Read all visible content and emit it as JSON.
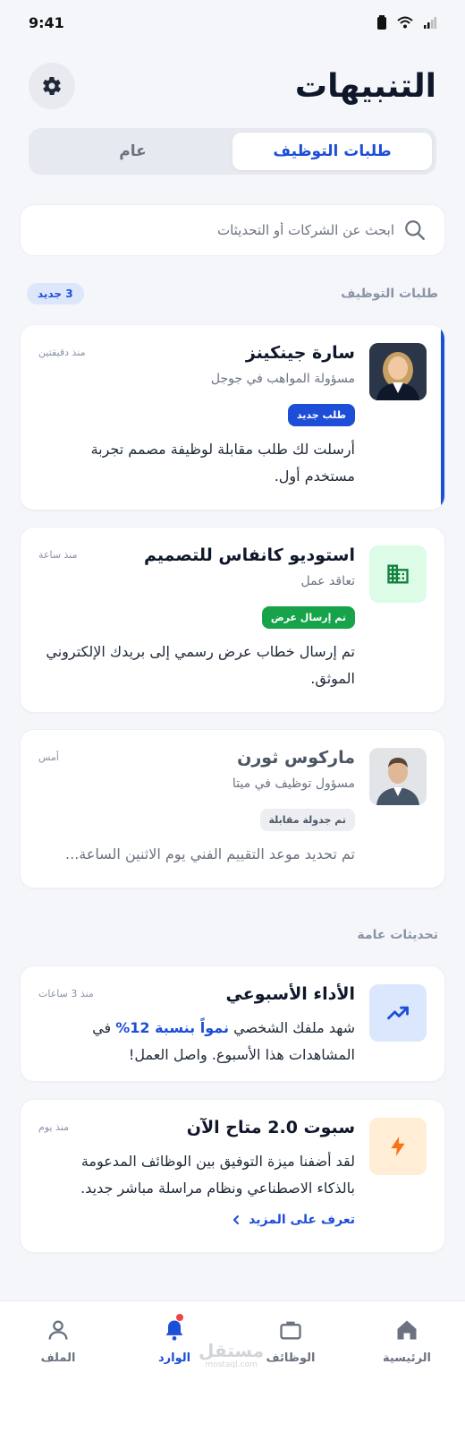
{
  "status_bar": {
    "time": "9:41"
  },
  "header": {
    "title": "التنبيهات"
  },
  "tabs": [
    {
      "label": "طلبات التوظيف",
      "active": true
    },
    {
      "label": "عام",
      "active": false
    }
  ],
  "search": {
    "placeholder": "ابحث عن الشركات أو التحديثات"
  },
  "applications_section": {
    "title": "طلبات التوظيف",
    "badge": "3 جديد"
  },
  "applications": [
    {
      "name": "سارة جينكينز",
      "subtitle": "مسؤولة المواهب في جوجل",
      "time": "منذ دقيقتين",
      "status": "طلب جديد",
      "body": "أرسلت لك طلب مقابلة لوظيفة مصمم تجربة مستخدم أول.",
      "unread": true
    },
    {
      "name": "استوديو كانفاس للتصميم",
      "subtitle": "تعاقد عمل",
      "time": "منذ ساعة",
      "status": "تم إرسال عرض",
      "body": "تم إرسال خطاب عرض رسمي إلى بريدك الإلكتروني الموثق."
    },
    {
      "name": "ماركوس ثورن",
      "subtitle": "مسؤول توظيف في ميتا",
      "time": "أمس",
      "status": "تم جدولة مقابلة",
      "body": "تم تحديد موعد التقييم الفني يوم الاثنين الساعة..."
    }
  ],
  "general_section": {
    "title": "تحديثات عامة"
  },
  "general": [
    {
      "title": "الأداء الأسبوعي",
      "time": "منذ 3 ساعات",
      "body_before": "شهد ملفك الشخصي",
      "body_highlight": "نمواً بنسبة 12%",
      "body_after": "في المشاهدات هذا الأسبوع. واصل العمل!"
    },
    {
      "title": "سبوت 2.0 متاح الآن",
      "time": "منذ يوم",
      "body": "لقد أضفنا ميزة التوفيق بين الوظائف المدعومة بالذكاء الاصطناعي ونظام مراسلة مباشر جديد.",
      "link": "تعرف على المزيد"
    }
  ],
  "bottom_nav": [
    {
      "label": "الرئيسية",
      "icon": "home-icon"
    },
    {
      "label": "الوظائف",
      "icon": "briefcase-icon"
    },
    {
      "label": "الوارد",
      "icon": "bell-icon",
      "active": true
    },
    {
      "label": "الملف",
      "icon": "user-icon"
    }
  ],
  "watermark": {
    "main": "مستقل",
    "sub": "mostaql.com"
  },
  "colors": {
    "accent": "#1d4ed8",
    "offer_green": "#16a34a",
    "warning_orange": "#f97316",
    "notification_red": "#ef4444"
  }
}
